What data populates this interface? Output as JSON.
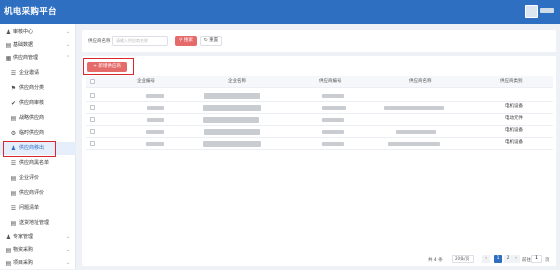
{
  "app": {
    "title": "机电采购平台"
  },
  "sidebar": {
    "items": [
      {
        "label": "审核中心",
        "icon": "user-icon",
        "chevron": "⌄"
      },
      {
        "label": "基础数据",
        "icon": "doc-icon",
        "chevron": "⌄"
      },
      {
        "label": "供应商管理",
        "icon": "grid-icon",
        "chevron": "⌃"
      },
      {
        "label": "企业邀请",
        "icon": "list-icon"
      },
      {
        "label": "供应商分类",
        "icon": "tag-icon"
      },
      {
        "label": "供应商审核",
        "icon": "check-icon"
      },
      {
        "label": "战略供应商",
        "icon": "doc-icon"
      },
      {
        "label": "临时供应商",
        "icon": "gear-icon"
      },
      {
        "label": "供应商移出",
        "icon": "user-remove-icon"
      },
      {
        "label": "供应商黑名单",
        "icon": "list-icon"
      },
      {
        "label": "企业评价",
        "icon": "doc-icon"
      },
      {
        "label": "供应商评价",
        "icon": "doc-icon"
      },
      {
        "label": "问题清单",
        "icon": "list-icon"
      },
      {
        "label": "送货地址管理",
        "icon": "doc-icon"
      },
      {
        "label": "专家管理",
        "icon": "user-icon",
        "chevron": "⌄"
      },
      {
        "label": "物资采购",
        "icon": "cart-icon",
        "chevron": "⌄"
      },
      {
        "label": "项目采购",
        "icon": "folder-icon",
        "chevron": "⌄"
      }
    ]
  },
  "search": {
    "label": "供应商名称",
    "placeholder": "请输入供应商名称",
    "search_button": "搜索",
    "reset_button": "重置"
  },
  "toolbar": {
    "add_button": "新增供应商"
  },
  "table": {
    "columns": [
      "企业编号",
      "企业名称",
      "供应商编号",
      "供应商名称",
      "供应商类别"
    ],
    "rows": [
      {
        "category": ""
      },
      {
        "category": "电机设备"
      },
      {
        "category": "电动元件"
      },
      {
        "category": "电机设备"
      },
      {
        "category": "电机设备"
      }
    ]
  },
  "pagination": {
    "total": "共 4 条",
    "page_size": "20条/页",
    "prev": "‹",
    "pages": [
      "1",
      "2"
    ],
    "next": "›",
    "goto_label": "前往",
    "goto_value": "1",
    "goto_suffix": "页"
  },
  "colors": {
    "primary": "#2f6fc2",
    "accent": "#e56a6a",
    "highlight": "#d9272e"
  }
}
